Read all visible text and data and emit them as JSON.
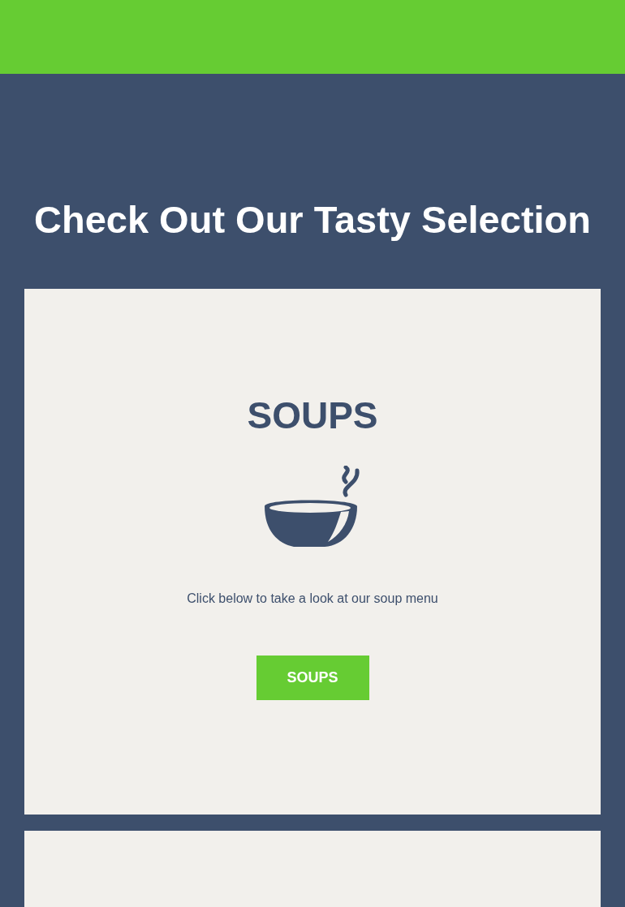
{
  "heading": "Check Out Our Tasty Selection",
  "cards": [
    {
      "title": "SOUPS",
      "description": "Click below to take a look at our soup menu",
      "button": "SOUPS"
    }
  ]
}
